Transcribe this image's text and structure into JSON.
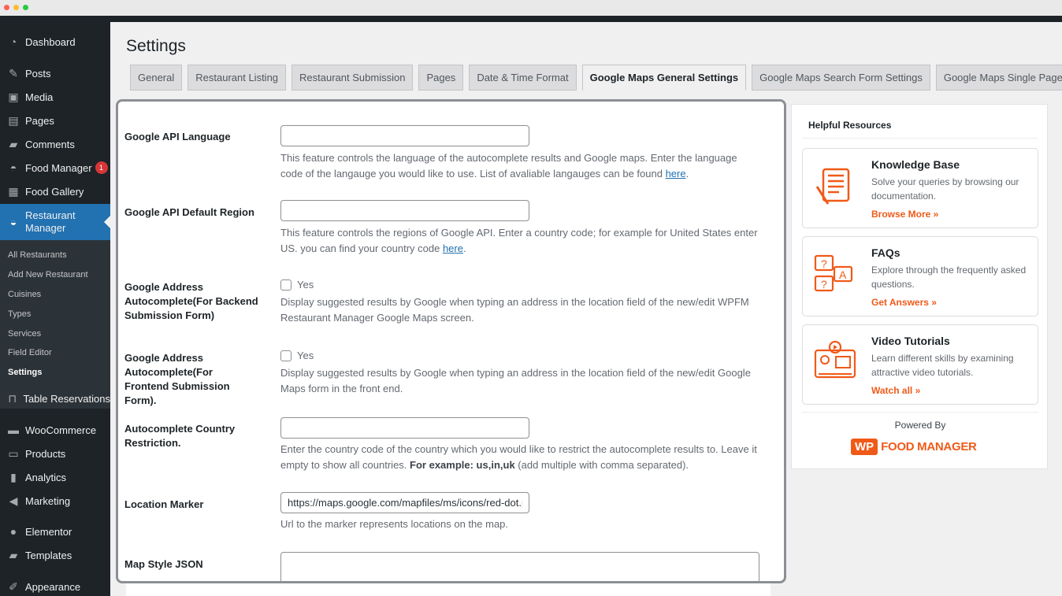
{
  "window": {
    "dot_colors": [
      "#ff5f57",
      "#febc2e",
      "#28c840"
    ]
  },
  "sidebar": {
    "items": [
      {
        "label": "Dashboard",
        "icon": "dashboard-icon"
      },
      {
        "label": "Posts",
        "icon": "pin-icon"
      },
      {
        "label": "Media",
        "icon": "media-icon"
      },
      {
        "label": "Pages",
        "icon": "page-icon"
      },
      {
        "label": "Comments",
        "icon": "comment-icon"
      },
      {
        "label": "Food Manager",
        "icon": "food-manager-icon",
        "badge": "1"
      },
      {
        "label": "Food Gallery",
        "icon": "gallery-icon"
      },
      {
        "label": "Restaurant Manager",
        "icon": "restaurant-icon"
      },
      {
        "label": "Table Reservations",
        "icon": "table-icon"
      },
      {
        "label": "WooCommerce",
        "icon": "woo-icon"
      },
      {
        "label": "Products",
        "icon": "archive-icon"
      },
      {
        "label": "Analytics",
        "icon": "chart-icon"
      },
      {
        "label": "Marketing",
        "icon": "megaphone-icon"
      },
      {
        "label": "Elementor",
        "icon": "elementor-icon"
      },
      {
        "label": "Templates",
        "icon": "folder-icon"
      },
      {
        "label": "Appearance",
        "icon": "brush-icon"
      }
    ],
    "submenu": [
      "All Restaurants",
      "Add New Restaurant",
      "Cuisines",
      "Types",
      "Services",
      "Field Editor",
      "Settings"
    ]
  },
  "page": {
    "title": "Settings"
  },
  "tabs": [
    "General",
    "Restaurant Listing",
    "Restaurant Submission",
    "Pages",
    "Date & Time Format",
    "Google Maps General Settings",
    "Google Maps Search Form Settings",
    "Google Maps Single Page Settings"
  ],
  "fields": {
    "api_language": {
      "label": "Google API Language",
      "value": "",
      "desc": "This feature controls the language of the autocomplete results and Google maps. Enter the language code of the langauge you would like to use. List of avaliable langauges can be found ",
      "link": "here",
      "desc_end": "."
    },
    "default_region": {
      "label": "Google API Default Region",
      "value": "",
      "desc": "This feature controls the regions of Google API. Enter a country code; for example for United States enter US. you can find your country code ",
      "link": "here",
      "desc_end": "."
    },
    "autocomplete_backend": {
      "label": "Google Address Autocomplete(For Backend Submission Form)",
      "checkbox_label": "Yes",
      "desc": "Display suggested results by Google when typing an address in the location field of the new/edit WPFM Restaurant Manager Google Maps screen."
    },
    "autocomplete_frontend": {
      "label": "Google Address Autocomplete(For Frontend Submission Form).",
      "checkbox_label": "Yes",
      "desc": "Display suggested results by Google when typing an address in the location field of the new/edit Google Maps form in the front end."
    },
    "country_restriction": {
      "label": "Autocomplete Country Restriction.",
      "value": "",
      "desc": "Enter the country code of the country which you would like to restrict the autocomplete results to. Leave it empty to show all countries. ",
      "example_bold": "For example: us,in,uk",
      "desc_end": " (add multiple with comma separated)."
    },
    "location_marker": {
      "label": "Location Marker",
      "value": "https://maps.google.com/mapfiles/ms/icons/red-dot.png",
      "desc": "Url to the marker represents locations on the map."
    },
    "map_style": {
      "label": "Map Style JSON",
      "value": ""
    }
  },
  "resources": {
    "title": "Helpful Resources",
    "cards": [
      {
        "title": "Knowledge Base",
        "desc": "Solve your queries by browsing our documentation.",
        "link": "Browse More »",
        "icon": "knowledge-base-icon"
      },
      {
        "title": "FAQs",
        "desc": "Explore through the frequently asked questions.",
        "link": "Get Answers »",
        "icon": "faq-icon"
      },
      {
        "title": "Video Tutorials",
        "desc": "Learn different skills by examining attractive video tutorials.",
        "link": "Watch all »",
        "icon": "video-tutorial-icon"
      }
    ],
    "powered_by": "Powered By",
    "brand_wp": "WP",
    "brand_name": "FOOD MANAGER"
  },
  "colors": {
    "accent": "#2271b1",
    "brand": "#f05a19",
    "sidebar_bg": "#1d2327"
  }
}
